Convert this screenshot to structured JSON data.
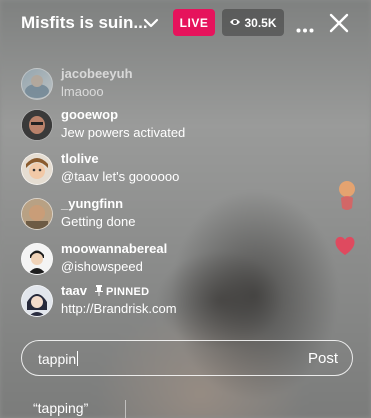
{
  "header": {
    "title": "Misfits is suin...",
    "live_label": "LIVE",
    "viewer_count": "30.5K"
  },
  "comments": [
    {
      "username": "jacobeeyuh",
      "text": "lmaooo"
    },
    {
      "username": "gooewop",
      "text": "Jew powers activated"
    },
    {
      "username": "tlolive",
      "text": "@taav let's goooooo"
    },
    {
      "username": "_yungfinn",
      "text": "Getting done"
    },
    {
      "username": "moowannabereal",
      "text": "@ishowspeed"
    },
    {
      "username": "taav",
      "pinned_label": "PINNED",
      "text": "http://Brandrisk.com"
    }
  ],
  "composer": {
    "input_value": "tappin",
    "post_label": "Post"
  },
  "suggestions": [
    "“tapping”"
  ],
  "colors": {
    "live_badge": "#e6135c",
    "heart": "#e8425a"
  }
}
